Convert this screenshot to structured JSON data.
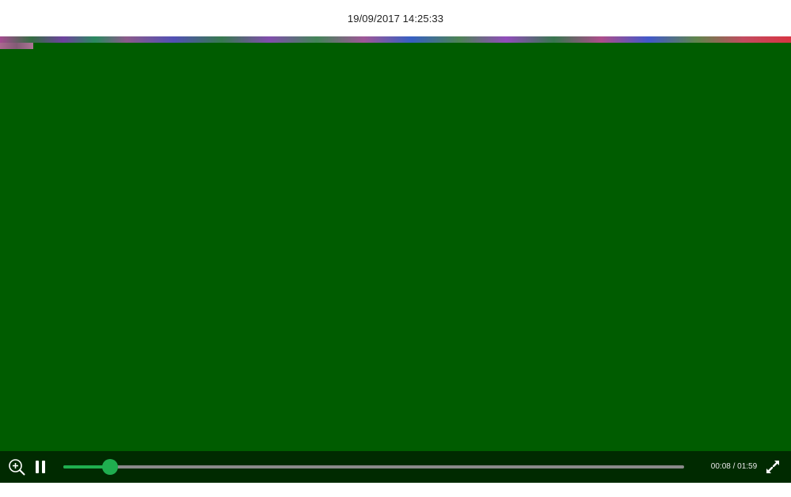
{
  "header": {
    "timestamp": "19/09/2017 14:25:33"
  },
  "video": {
    "background_color": "#005c00"
  },
  "controls": {
    "zoom_icon": "zoom-in-icon",
    "pause_icon": "pause-icon",
    "fullscreen_icon": "fullscreen-icon",
    "current_time": "00:08",
    "separator": " / ",
    "duration": "01:59",
    "time_text": "00:08 / 01:59",
    "progress_fraction": 0.075,
    "accent_color": "#1fae4f"
  }
}
